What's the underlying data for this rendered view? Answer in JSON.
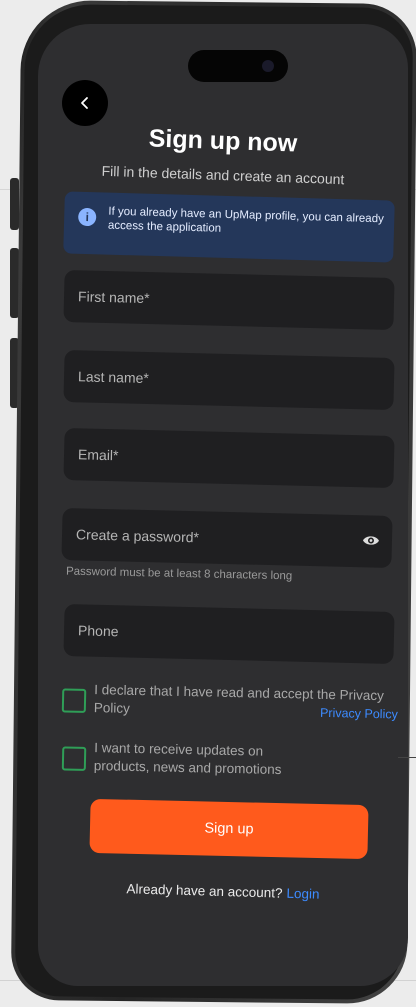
{
  "header": {
    "title": "Sign up now",
    "subtitle": "Fill in the details and create an account"
  },
  "info": {
    "icon": "info-icon",
    "text": "If you already have an UpMap profile, you can already access the application"
  },
  "form": {
    "first_name": {
      "placeholder": "First name*",
      "value": ""
    },
    "last_name": {
      "placeholder": "Last name*",
      "value": ""
    },
    "email": {
      "placeholder": "Email*",
      "value": ""
    },
    "password": {
      "placeholder": "Create a password*",
      "value": "",
      "hint": "Password must be at least 8 characters long"
    },
    "phone": {
      "placeholder": "Phone",
      "value": ""
    }
  },
  "consents": {
    "privacy_text": "I declare that I have read and accept the Privacy Policy",
    "privacy_link": "Privacy Policy",
    "updates_text": "I want to receive updates on products, news and promotions"
  },
  "actions": {
    "signup_label": "Sign up",
    "login_prompt": "Already have an account?",
    "login_link": "Login"
  },
  "colors": {
    "accent": "#ff5a1c",
    "link": "#3d8bff",
    "checkbox_border": "#2f9e57",
    "info_bg": "#24375a"
  }
}
